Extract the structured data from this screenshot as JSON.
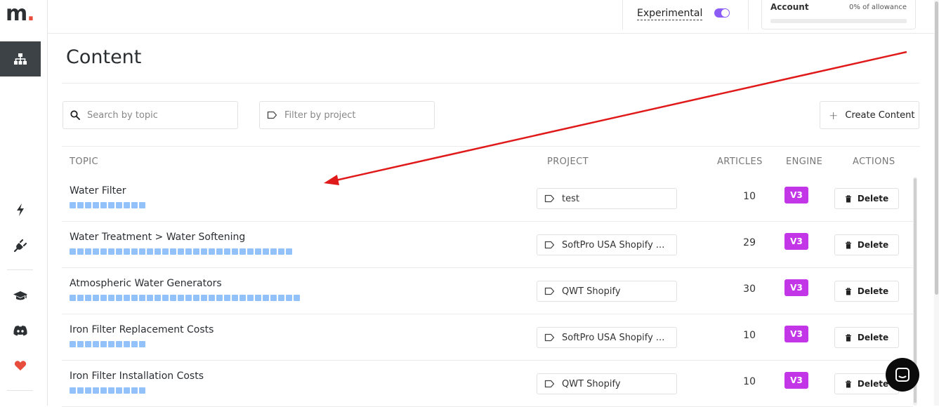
{
  "sidebar": {
    "logo_text": "m",
    "logo_dot": ".",
    "icons": [
      "sitemap-icon",
      "bolt-icon",
      "plug-icon",
      "graduation-cap-icon",
      "discord-icon",
      "heart-icon"
    ]
  },
  "header": {
    "experimental_label": "Experimental",
    "experimental_on": true,
    "account_label": "Account",
    "allowance_text": "0% of allowance",
    "allowance_fraction": 0
  },
  "main": {
    "title": "Content",
    "search_placeholder": "Search by topic",
    "filter_placeholder": "Filter by project",
    "create_label": "Create Content",
    "columns": {
      "topic": "TOPIC",
      "project": "PROJECT",
      "articles": "ARTICLES",
      "engine": "ENGINE",
      "actions": "ACTIONS"
    },
    "rows": [
      {
        "topic": "Water Filter",
        "project": "test",
        "articles": "10",
        "engine": "V3",
        "action": "Delete",
        "progress_segments": 10
      },
      {
        "topic": "Water Treatment > Water Softening",
        "project": "SoftPro USA Shopify ...",
        "articles": "29",
        "engine": "V3",
        "action": "Delete",
        "progress_segments": 29
      },
      {
        "topic": "Atmospheric Water Generators",
        "project": "QWT Shopify",
        "articles": "30",
        "engine": "V3",
        "action": "Delete",
        "progress_segments": 30
      },
      {
        "topic": "Iron Filter Replacement Costs",
        "project": "SoftPro USA Shopify ...",
        "articles": "10",
        "engine": "V3",
        "action": "Delete",
        "progress_segments": 10
      },
      {
        "topic": "Iron Filter Installation Costs",
        "project": "QWT Shopify",
        "articles": "10",
        "engine": "V3",
        "action": "Delete",
        "progress_segments": 10
      }
    ]
  },
  "colors": {
    "engine_badge": "#c236e8",
    "progress": "#93c1fa",
    "toggle": "#8b5cf6",
    "annotation_arrow": "#e01a1a"
  }
}
